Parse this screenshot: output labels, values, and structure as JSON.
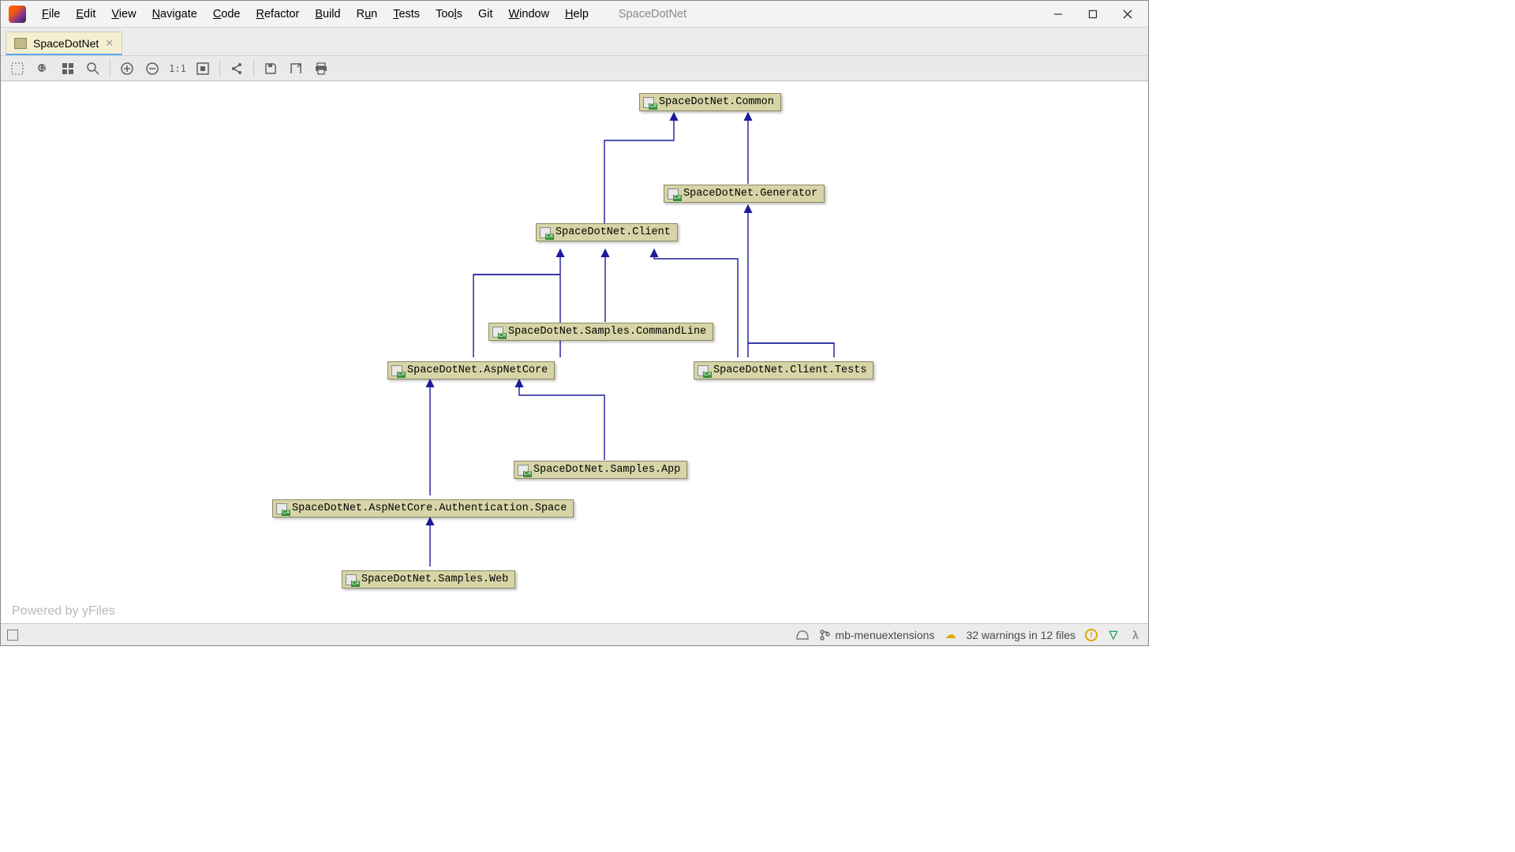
{
  "app": {
    "project_name": "SpaceDotNet"
  },
  "menu": {
    "file": "File",
    "edit": "Edit",
    "view": "View",
    "navigate": "Navigate",
    "code": "Code",
    "refactor": "Refactor",
    "build": "Build",
    "run": "Run",
    "tests": "Tests",
    "tools": "Tools",
    "git": "Git",
    "window": "Window",
    "help": "Help"
  },
  "tab": {
    "label": "SpaceDotNet"
  },
  "nodes": {
    "common": "SpaceDotNet.Common",
    "generator": "SpaceDotNet.Generator",
    "client": "SpaceDotNet.Client",
    "samples_cmd": "SpaceDotNet.Samples.CommandLine",
    "aspnetcore": "SpaceDotNet.AspNetCore",
    "client_tests": "SpaceDotNet.Client.Tests",
    "samples_app": "SpaceDotNet.Samples.App",
    "auth_space": "SpaceDotNet.AspNetCore.Authentication.Space",
    "samples_web": "SpaceDotNet.Samples.Web"
  },
  "watermark": "Powered by yFiles",
  "status": {
    "branch": "mb-menuextensions",
    "warnings": "32 warnings in 12 files"
  },
  "chart_data": {
    "type": "diagram",
    "title": "Project dependency diagram",
    "nodes": [
      "SpaceDotNet.Common",
      "SpaceDotNet.Generator",
      "SpaceDotNet.Client",
      "SpaceDotNet.Samples.CommandLine",
      "SpaceDotNet.AspNetCore",
      "SpaceDotNet.Client.Tests",
      "SpaceDotNet.Samples.App",
      "SpaceDotNet.AspNetCore.Authentication.Space",
      "SpaceDotNet.Samples.Web"
    ],
    "edges": [
      [
        "SpaceDotNet.Generator",
        "SpaceDotNet.Common"
      ],
      [
        "SpaceDotNet.Client",
        "SpaceDotNet.Common"
      ],
      [
        "SpaceDotNet.Samples.CommandLine",
        "SpaceDotNet.Client"
      ],
      [
        "SpaceDotNet.AspNetCore",
        "SpaceDotNet.Client"
      ],
      [
        "SpaceDotNet.Client.Tests",
        "SpaceDotNet.Client"
      ],
      [
        "SpaceDotNet.Client.Tests",
        "SpaceDotNet.Generator"
      ],
      [
        "SpaceDotNet.Samples.App",
        "SpaceDotNet.AspNetCore"
      ],
      [
        "SpaceDotNet.AspNetCore.Authentication.Space",
        "SpaceDotNet.AspNetCore"
      ],
      [
        "SpaceDotNet.Samples.Web",
        "SpaceDotNet.AspNetCore.Authentication.Space"
      ]
    ]
  }
}
